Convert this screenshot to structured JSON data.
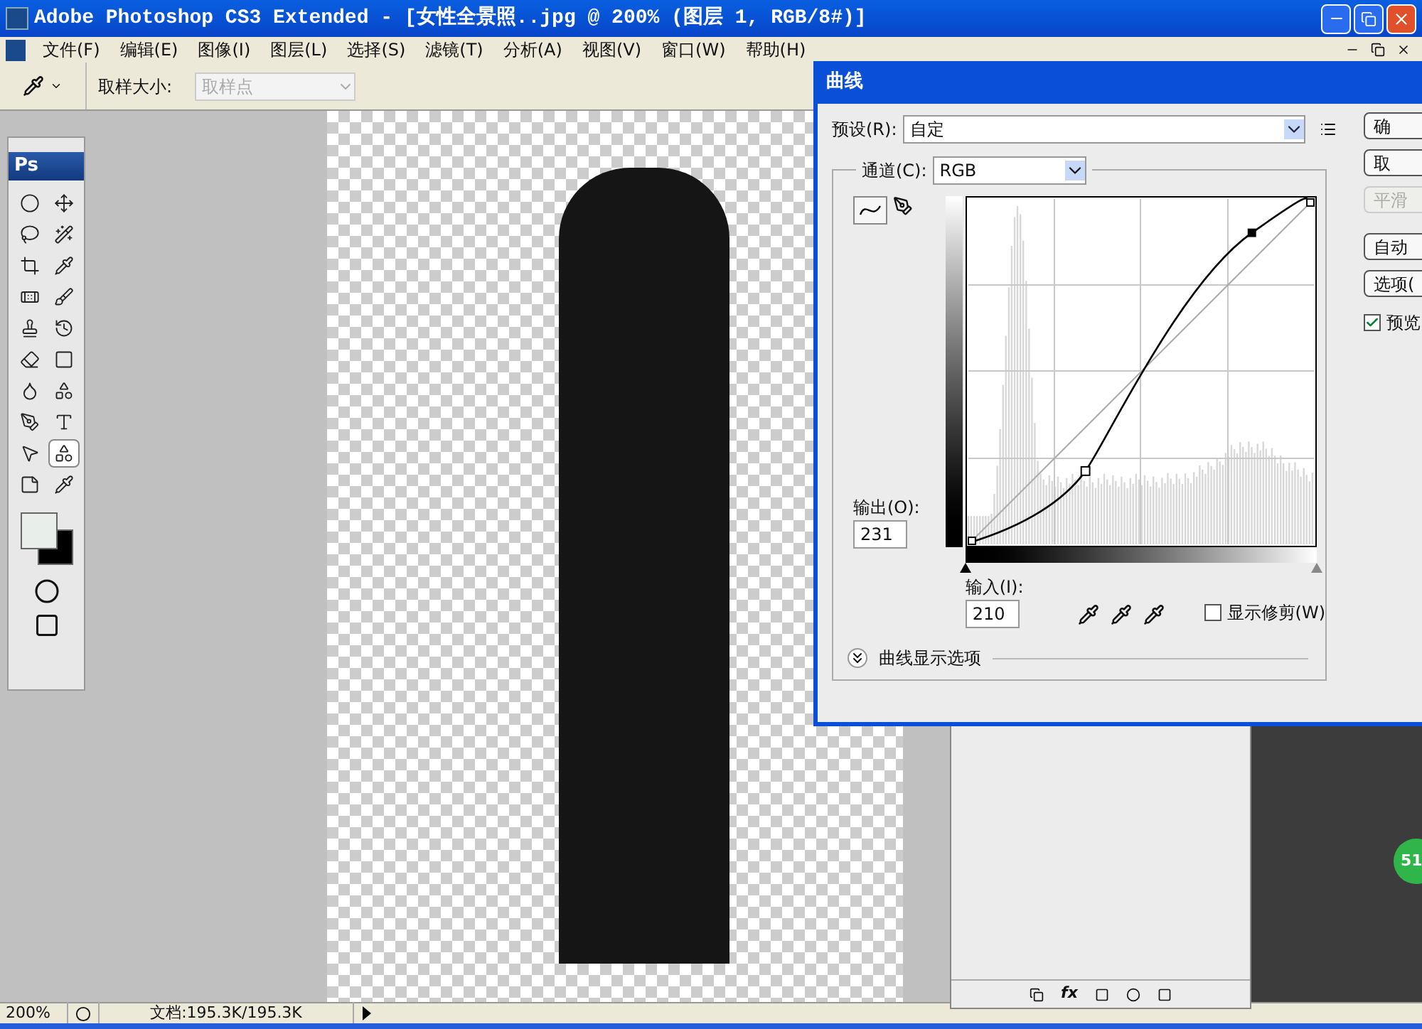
{
  "window": {
    "title": "Adobe Photoshop CS3 Extended - [女性全景照..jpg @ 200% (图层 1, RGB/8#)]"
  },
  "menu": [
    {
      "label": "文件(F)"
    },
    {
      "label": "编辑(E)"
    },
    {
      "label": "图像(I)"
    },
    {
      "label": "图层(L)"
    },
    {
      "label": "选择(S)"
    },
    {
      "label": "滤镜(T)"
    },
    {
      "label": "分析(A)"
    },
    {
      "label": "视图(V)"
    },
    {
      "label": "窗口(W)"
    },
    {
      "label": "帮助(H)"
    }
  ],
  "options_bar": {
    "sample_size_label": "取样大小:",
    "sample_size": {
      "value": "取样点",
      "disabled": true
    }
  },
  "toolbox": {
    "logo": "Ps",
    "tools": [
      {
        "selected": false
      },
      {
        "selected": false
      },
      {
        "selected": false
      },
      {
        "selected": false
      },
      {
        "selected": false
      },
      {
        "selected": false
      },
      {
        "selected": false
      },
      {
        "selected": false
      },
      {
        "selected": false
      },
      {
        "selected": false
      },
      {
        "selected": false
      },
      {
        "selected": false
      },
      {
        "selected": false
      },
      {
        "selected": false
      },
      {
        "selected": false
      },
      {
        "selected": false
      },
      {
        "selected": false
      },
      {
        "selected": true
      },
      {
        "selected": false
      },
      {
        "selected": false
      }
    ]
  },
  "curves_dialog": {
    "title": "曲线",
    "preset_label": "预设(R):",
    "preset": "自定",
    "channel_label": "通道(C):",
    "channel": "RGB",
    "output_label": "输出(O):",
    "output": "231",
    "input_label": "输入(I):",
    "input": "210",
    "show_clipping": {
      "label": "显示修剪(W)",
      "checked": false
    },
    "display_options": "曲线显示选项",
    "buttons": [
      {
        "label": "确",
        "disabled": false
      },
      {
        "label": "取",
        "disabled": false
      },
      {
        "label": "平滑",
        "disabled": true
      },
      {
        "label": "自动",
        "disabled": false
      },
      {
        "label": "选项(",
        "disabled": false
      }
    ],
    "input_black_point": {
      "level": 0
    },
    "input_white_point": {
      "level": 1
    },
    "preview": {
      "label": "预览",
      "checked": true
    }
  },
  "layers_panel": {
    "fx": "fx"
  },
  "side_badge": "51",
  "status_bar": {
    "zoom": "200%",
    "doc_info": "文档:195.3K/195.3K"
  }
}
